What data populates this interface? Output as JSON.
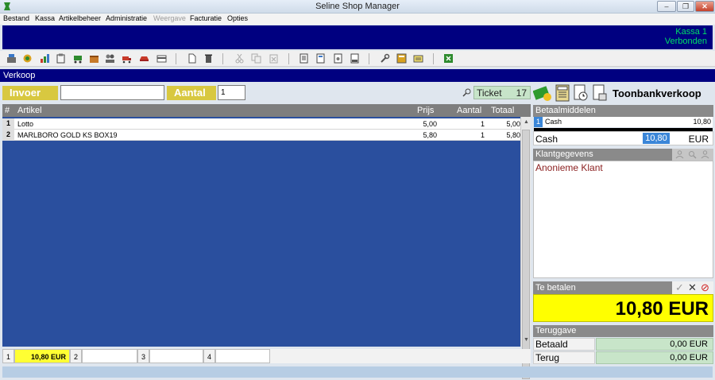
{
  "window": {
    "title": "Seline Shop Manager",
    "minimize": "–",
    "restore": "❐",
    "close": "✕"
  },
  "menu": [
    "Bestand",
    "Kassa",
    "Artikelbeheer",
    "Administratie",
    "Weergave",
    "Facturatie",
    "Opties"
  ],
  "banner": {
    "register": "Kassa  1",
    "status": "Verbonden"
  },
  "section": {
    "title": "Verkoop"
  },
  "entry": {
    "invoer_label": "Invoer",
    "invoer_value": "",
    "aantal_label": "Aantal",
    "aantal_value": "1"
  },
  "ticket": {
    "label": "Ticket",
    "number": "17"
  },
  "grid": {
    "columns": {
      "num": "#",
      "artikel": "Artikel",
      "prijs": "Prijs",
      "aantal": "Aantal",
      "totaal": "Totaal"
    },
    "rows": [
      {
        "num": "1",
        "artikel": "Lotto",
        "prijs": "5,00",
        "aantal": "1",
        "totaal": "5,00"
      },
      {
        "num": "2",
        "artikel": "MARLBORO GOLD KS BOX19",
        "prijs": "5,80",
        "aantal": "1",
        "totaal": "5,80"
      }
    ]
  },
  "bottom_tabs": [
    {
      "num": "1",
      "value": "10,80 EUR"
    },
    {
      "num": "2",
      "value": ""
    },
    {
      "num": "3",
      "value": ""
    },
    {
      "num": "4",
      "value": ""
    }
  ],
  "right": {
    "title": "Toonbankverkoop",
    "betaalmiddelen": {
      "head": "Betaalmiddelen",
      "row": {
        "idx": "1",
        "name": "Cash",
        "amount": "10,80"
      }
    },
    "cash": {
      "label": "Cash",
      "value": "10,80",
      "currency": "EUR"
    },
    "klant": {
      "head": "Klantgegevens",
      "name": "Anonieme Klant"
    },
    "te_betalen": {
      "head": "Te betalen",
      "amount": "10,80 EUR",
      "confirm": "✓",
      "cancel": "✕",
      "block": "⊘"
    },
    "teruggave": {
      "head": "Teruggave",
      "betaald_label": "Betaald",
      "betaald_value": "0,00 EUR",
      "terug_label": "Terug",
      "terug_value": "0,00 EUR"
    }
  },
  "icons": {
    "toolbar": [
      "cashier-icon",
      "refresh-icon",
      "chart-icon",
      "clipboard-icon",
      "cart-icon",
      "box-icon",
      "users-icon",
      "truck-icon",
      "car-icon",
      "card-icon",
      "new-document-icon",
      "trash-icon",
      "cut-icon",
      "copy-icon",
      "paste-icon",
      "report-icon",
      "report-list-icon",
      "report-page-icon",
      "report-print-icon",
      "wrench-icon",
      "calculator-icon",
      "keyboard-icon",
      "excel-icon"
    ]
  },
  "colors": {
    "navy": "#000080",
    "accent_yellow": "#ffff00",
    "green_text": "#00dd66",
    "grid_blue": "#2a4f9e"
  }
}
